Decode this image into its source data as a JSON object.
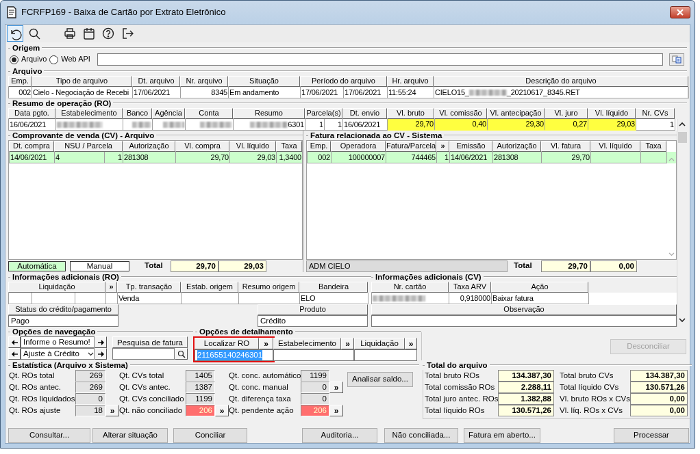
{
  "window": {
    "title": "FCRFP169 - Baixa de Cartão por Extrato Eletrônico"
  },
  "toolbar": [
    {
      "kind": "undo",
      "selected": true
    },
    {
      "kind": "search",
      "selected": false
    },
    {
      "kind": "print",
      "selected": false
    },
    {
      "kind": "calendar",
      "selected": false
    },
    {
      "kind": "help",
      "selected": false
    },
    {
      "kind": "exit",
      "selected": false
    }
  ],
  "origem": {
    "title": "Origem",
    "options": [
      {
        "label": "Arquivo",
        "selected": true
      },
      {
        "label": "Web API",
        "selected": false
      }
    ]
  },
  "arquivo": {
    "title": "Arquivo",
    "columns": [
      "Emp.",
      "Tipo de arquivo",
      "Dt. arquivo",
      "Nr. arquivo",
      "Situação",
      "Período do arquivo",
      "Hr. arquivo",
      "Descrição do arquivo"
    ],
    "rows": [
      {
        "selected": false,
        "cells": [
          "002",
          "Cielo - Negociação de Recebi",
          "17/06/2021",
          "8345",
          "Em andamento",
          [
            "17/06/2021",
            "17/06/2021"
          ],
          "11:55:24",
          {
            "before": "CIELO15_",
            "after": "_20210617_8345.RET",
            "redacted": true
          }
        ]
      }
    ]
  },
  "resumo": {
    "title": "Resumo de operação (RO)",
    "columns": [
      "Data pgto.",
      "Estabelecimento",
      "Banco",
      "Agência",
      "Conta",
      "Resumo",
      "Parcela(s)",
      "Dt. envio",
      "Vl. bruto",
      "Vl. comissão",
      "Vl. antecipação",
      "Vl. juro",
      "Vl. líquido",
      "Nr. CVs"
    ],
    "rows": [
      {
        "selected": false,
        "cells": [
          "16/06/2021",
          {
            "redacted": true
          },
          {
            "redacted": true
          },
          {
            "redacted": true
          },
          {
            "redacted": true
          },
          {
            "redacted": true,
            "after": "6301"
          },
          [
            "1",
            "1"
          ],
          "16/06/2021",
          {
            "text": "29,70",
            "highlighted": true
          },
          {
            "text": "0,40",
            "highlighted": true
          },
          {
            "text": "29,30",
            "highlighted": true
          },
          {
            "text": "0,27",
            "highlighted": true
          },
          {
            "text": "29,03",
            "highlighted": true
          },
          "1"
        ]
      }
    ]
  },
  "cv": {
    "title": "Comprovante de venda (CV) - Arquivo",
    "columns": [
      "Dt. compra",
      "NSU / Parcela",
      "Autorização",
      "Vl. compra",
      "Vl. líquido",
      "Taxa"
    ],
    "rows": [
      {
        "selected": true,
        "cells": [
          "14/06/2021",
          [
            "4",
            "1"
          ],
          "281308",
          "29,70",
          "29,03",
          "1,3400"
        ]
      }
    ],
    "modes": [
      {
        "label": "Automática",
        "selected": true
      },
      {
        "label": "Manual",
        "selected": false
      }
    ],
    "total_label": "Total",
    "totals": [
      "29,70",
      "29,03"
    ]
  },
  "fatura": {
    "title": "Fatura relacionada ao CV - Sistema",
    "columns": [
      "Emp.",
      "Operadora",
      "Fatura/Parcela",
      {
        "label": "»",
        "kind": "button"
      },
      "Emissão",
      "Autorização",
      "Vl. fatura",
      "Vl. líquido",
      "Taxa"
    ],
    "rows": [
      {
        "selected": true,
        "cells": [
          "002",
          "100000007",
          "744465",
          "1",
          "14/06/2021",
          "281308",
          "29,70"
        ]
      }
    ],
    "operator": "ADM CIELO",
    "total_label": "Total",
    "totals": [
      "29,70",
      "0,00"
    ]
  },
  "info_ro": {
    "title": "Informações adicionais (RO)",
    "columns": [
      {
        "label": "Liquidação"
      },
      {
        "label": "»",
        "kind": "button"
      },
      {
        "label": "Tp. transação",
        "value": "Venda"
      },
      {
        "label": "Estab. origem"
      },
      {
        "label": "Resumo origem"
      },
      {
        "label": "Bandeira",
        "value": "ELO"
      }
    ],
    "status_label": "Status do crédito/pagamento",
    "status": "Pago",
    "produto_label": "Produto",
    "produto": "Crédito"
  },
  "info_cv": {
    "title": "Informações adicionais (CV)",
    "columns": [
      "Nr. cartão",
      "Taxa ARV",
      "Ação"
    ],
    "values": [
      {
        "redacted": true
      },
      "0,918000",
      "Baixar fatura"
    ],
    "obs_label": "Observação"
  },
  "navegacao": {
    "title": "Opções de navegação",
    "items": [
      {
        "kind": "text",
        "text": "Informe o Resumo!"
      },
      {
        "kind": "dropdown",
        "text": "Ajuste à Crédito"
      }
    ],
    "search_label": "Pesquisa de fatura"
  },
  "detalhamento": {
    "title": "Opções de detalhamento",
    "fields": [
      {
        "label": "Localizar RO",
        "button": "»",
        "value": "211655140246301",
        "selected": true
      },
      {
        "label": "Estabelecimento",
        "button": "»",
        "selected": false
      },
      {
        "label": "Liquidação",
        "button": "»",
        "selected": false
      }
    ]
  },
  "desconciliar": {
    "label": "Desconciliar",
    "disabled": true
  },
  "estatistica": {
    "title": "Estatística (Arquivo x Sistema)",
    "columns": [
      [
        {
          "label": "Qt. ROs total",
          "value": "269",
          "alert": false
        },
        {
          "label": "Qt. ROs antec.",
          "value": "269",
          "alert": false
        },
        {
          "label": "Qt. ROs liquidados",
          "value": "0",
          "alert": false
        },
        {
          "label": "Qt. ROs ajuste",
          "value": "18",
          "alert": false,
          "button": "»"
        }
      ],
      [
        {
          "label": "Qt. CVs total",
          "value": "1405",
          "alert": false
        },
        {
          "label": "Qt. CVs antec.",
          "value": "1387",
          "alert": false
        },
        {
          "label": "Qt. CVs conciliado",
          "value": "1199",
          "alert": false
        },
        {
          "label": "Qt. não conciliado",
          "value": "206",
          "alert": true,
          "button": "»"
        }
      ],
      [
        {
          "label": "Qt. conc. automático",
          "value": "1199",
          "alert": false
        },
        {
          "label": "Qt. conc. manual",
          "value": "0",
          "alert": false,
          "button": "»"
        },
        {
          "label": "Qt. diferença taxa",
          "value": "0",
          "alert": false
        },
        {
          "label": "Qt. pendente ação",
          "value": "206",
          "alert": true,
          "button": "»"
        }
      ]
    ],
    "action": "Analisar saldo..."
  },
  "totais": {
    "title": "Total do arquivo",
    "columns": [
      [
        {
          "label": "Total bruto ROs",
          "value": "134.387,30"
        },
        {
          "label": "Total comissão ROs",
          "value": "2.288,11"
        },
        {
          "label": "Total juro antec. ROs",
          "value": "1.382,88"
        },
        {
          "label": "Total líquido ROs",
          "value": "130.571,26"
        }
      ],
      [
        {
          "label": "Total bruto CVs",
          "value": "134.387,30"
        },
        {
          "label": "Total líquido CVs",
          "value": "130.571,26"
        },
        {
          "label": "Vl. bruto ROs x CVs",
          "value": "0,00"
        },
        {
          "label": "Vl. líq. ROs x CVs",
          "value": "0,00"
        }
      ]
    ]
  },
  "buttons": [
    {
      "label": "Consultar...",
      "disabled": false
    },
    {
      "label": "Alterar situação",
      "disabled": false
    },
    {
      "label": "Conciliar",
      "disabled": false
    },
    {
      "label": "Auditoria...",
      "disabled": false
    },
    {
      "label": "Não conciliada...",
      "disabled": false
    },
    {
      "label": "Fatura em aberto...",
      "disabled": false
    },
    {
      "label": "Processar",
      "disabled": false
    }
  ]
}
